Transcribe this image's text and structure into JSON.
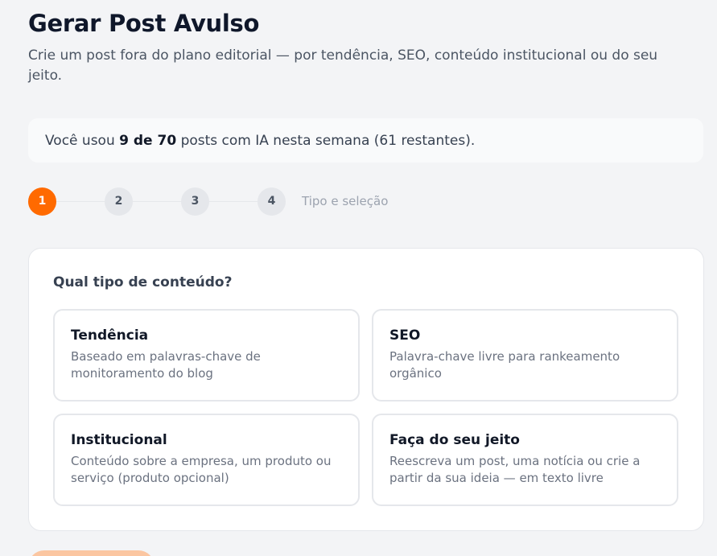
{
  "header": {
    "title": "Gerar Post Avulso",
    "subtitle": "Crie um post fora do plano editorial — por tendência, SEO, conteúdo institucional ou do seu jeito."
  },
  "usage": {
    "prefix": "Você usou ",
    "used_bold": "9 de 70",
    "suffix": " posts com IA nesta semana (61 restantes)."
  },
  "stepper": {
    "steps": [
      "1",
      "2",
      "3",
      "4"
    ],
    "active_step": 1,
    "current_label": "Tipo e seleção"
  },
  "content_type": {
    "question": "Qual tipo de conteúdo?",
    "options": [
      {
        "title": "Tendência",
        "description": "Baseado em palavras-chave de monitoramento do blog"
      },
      {
        "title": "SEO",
        "description": "Palavra-chave livre para rankeamento orgânico"
      },
      {
        "title": "Institucional",
        "description": "Conteúdo sobre a empresa, um produto ou serviço (produto opcional)"
      },
      {
        "title": "Faça do seu jeito",
        "description": "Reescreva um post, uma notícia ou crie a partir da sua ideia — em texto livre"
      }
    ]
  },
  "colors": {
    "accent": "#ff6a00",
    "background": "#f3f4f6"
  }
}
